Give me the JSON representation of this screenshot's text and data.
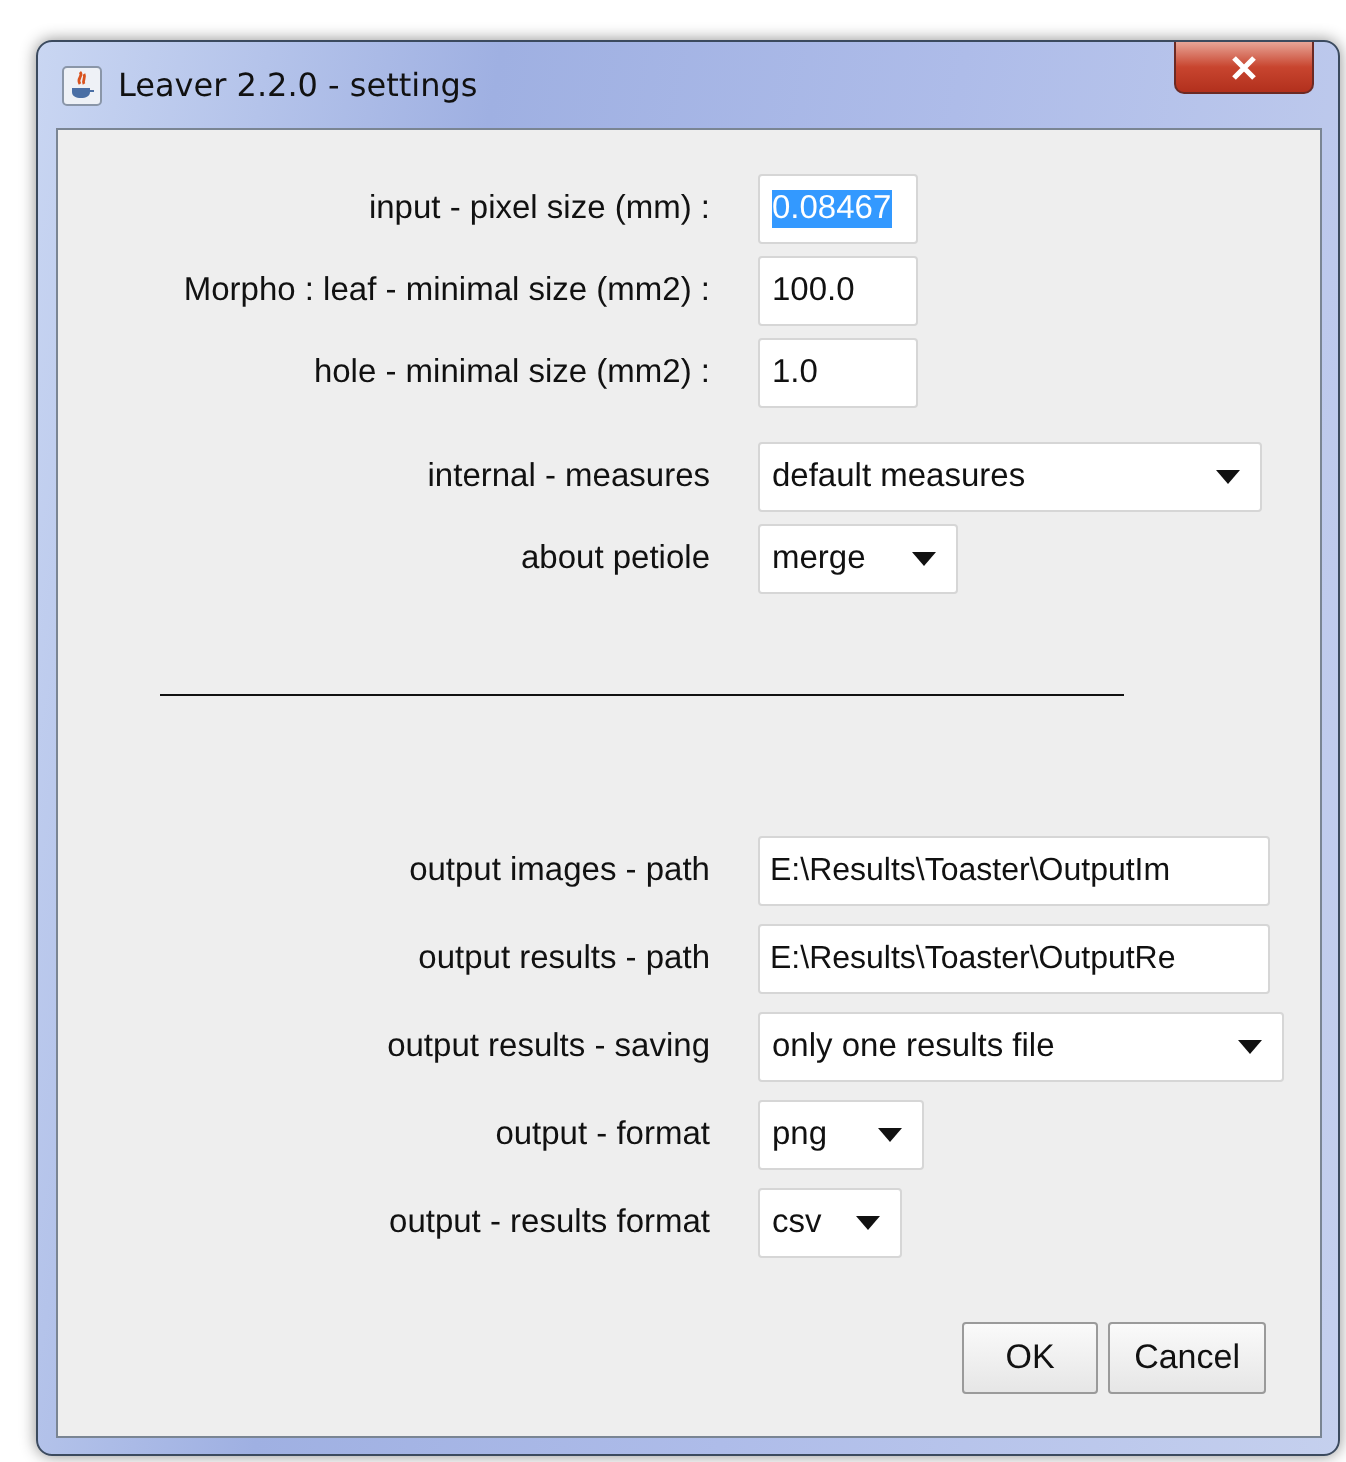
{
  "window": {
    "title": "Leaver 2.2.0 - settings"
  },
  "sections": [
    {
      "rows": [
        {
          "kind": "text",
          "label": "input - pixel size (mm) :",
          "value": "0.08467",
          "selected": true
        },
        {
          "kind": "text",
          "label": "Morpho : leaf - minimal size (mm2) :",
          "value": "100.0",
          "selected": false
        },
        {
          "kind": "text",
          "label": "hole - minimal size (mm2) :",
          "value": "1.0",
          "selected": false
        },
        {
          "kind": "select",
          "label": "internal - measures",
          "value": "default measures"
        },
        {
          "kind": "select",
          "label": "about petiole",
          "value": "merge"
        }
      ]
    },
    {
      "rows": [
        {
          "kind": "path",
          "label": "output images  - path",
          "value": "E:\\Results\\Toaster\\OutputIm",
          "selected": false
        },
        {
          "kind": "path",
          "label": "output results - path",
          "value": "E:\\Results\\Toaster\\OutputRe",
          "selected": false
        },
        {
          "kind": "select",
          "label": "output results - saving",
          "value": "only one results file"
        },
        {
          "kind": "select",
          "label": "output - format",
          "value": "png"
        },
        {
          "kind": "select",
          "label": "output - results format",
          "value": "csv"
        }
      ]
    }
  ],
  "buttons": [
    "OK",
    "Cancel"
  ]
}
